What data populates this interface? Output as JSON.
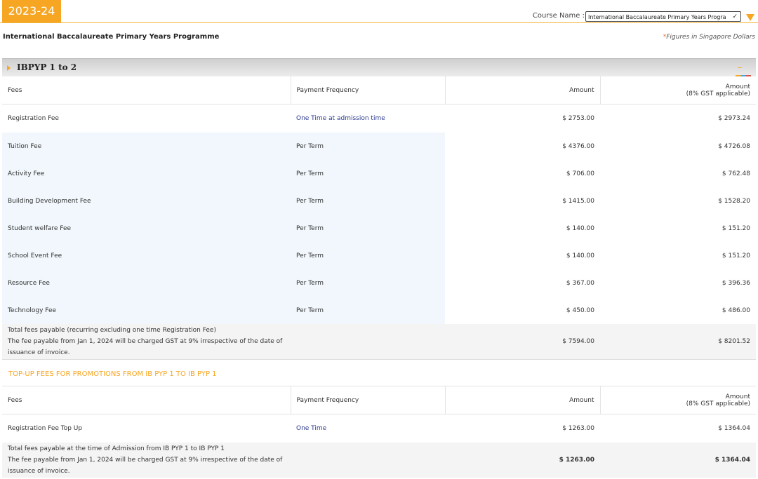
{
  "header": {
    "year": "2023-24",
    "course_label": "Course Name :",
    "course_value": "International Baccalaureate Primary Years Programme"
  },
  "programme_title": "International Baccalaureate Primary Years Programme",
  "currency_note": "Figures in Singapore Dollars",
  "section": {
    "title": "IBPYP 1 to 2",
    "collapse_symbol": "–"
  },
  "columns": {
    "fees": "Fees",
    "frequency": "Payment Frequency",
    "amount": "Amount",
    "amount_gst_line1": "Amount",
    "amount_gst_line2": "(8% GST applicable)"
  },
  "fees": [
    {
      "name": "Registration Fee",
      "frequency": "One Time at admission time",
      "amount": "$ 2753.00",
      "amount_gst": "$ 2973.24"
    },
    {
      "name": "Tuition Fee",
      "frequency": "Per Term",
      "amount": "$ 4376.00",
      "amount_gst": "$ 4726.08"
    },
    {
      "name": "Activity Fee",
      "frequency": "Per Term",
      "amount": "$ 706.00",
      "amount_gst": "$ 762.48"
    },
    {
      "name": "Building Development Fee",
      "frequency": "Per Term",
      "amount": "$ 1415.00",
      "amount_gst": "$ 1528.20"
    },
    {
      "name": "Student welfare Fee",
      "frequency": "Per Term",
      "amount": "$ 140.00",
      "amount_gst": "$ 151.20"
    },
    {
      "name": "School Event Fee",
      "frequency": "Per Term",
      "amount": "$ 140.00",
      "amount_gst": "$ 151.20"
    },
    {
      "name": "Resource Fee",
      "frequency": "Per Term",
      "amount": "$ 367.00",
      "amount_gst": "$ 396.36"
    },
    {
      "name": "Technology Fee",
      "frequency": "Per Term",
      "amount": "$ 450.00",
      "amount_gst": "$ 486.00"
    }
  ],
  "total": {
    "line1": "Total fees payable (recurring excluding one time Registration Fee)",
    "line2": "The fee payable from Jan 1, 2024 will be charged GST at 9% irrespective of the date of",
    "line3": "issuance of invoice.",
    "amount": "$ 7594.00",
    "amount_gst": "$ 8201.52"
  },
  "topup": {
    "title": "TOP-UP FEES FOR PROMOTIONS FROM IB PYP 1 TO IB PYP 1",
    "fees": [
      {
        "name": "Registration Fee Top Up",
        "frequency": "One Time",
        "amount": "$ 1263.00",
        "amount_gst": "$ 1364.04"
      }
    ],
    "total": {
      "line1": "Total fees payable at the time of Admission from IB PYP 1 to IB PYP 1",
      "line2": "The fee payable from Jan 1, 2024 will be charged GST at 9% irrespective of the date of",
      "line3": "issuance of invoice.",
      "amount": "$ 1263.00",
      "amount_gst": "$ 1364.04"
    }
  }
}
